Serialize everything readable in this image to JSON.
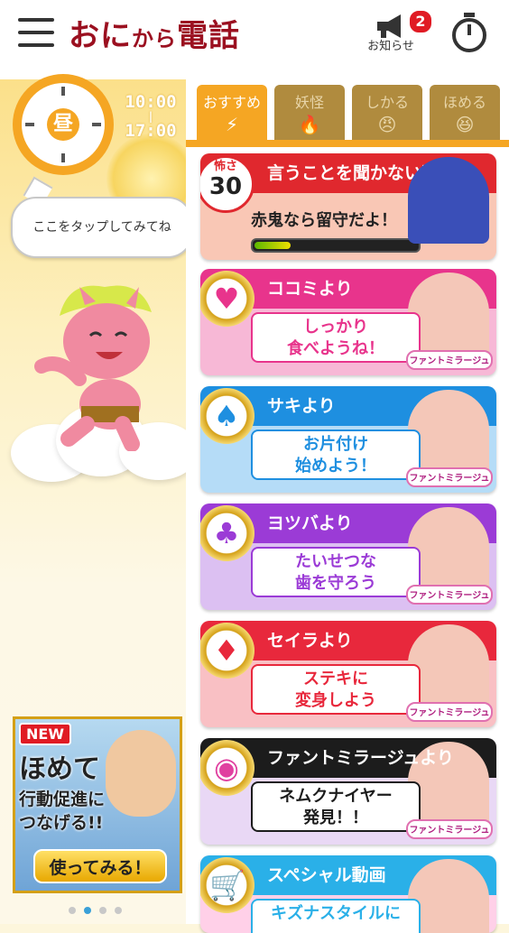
{
  "header": {
    "title_main": "おに",
    "title_small": "から",
    "title_end": "電話",
    "notice_label": "お知らせ",
    "notice_count": "2",
    "icons": {
      "menu": "hamburger-menu-icon",
      "notice": "megaphone-icon",
      "timer": "stopwatch-icon"
    }
  },
  "clock": {
    "period": "昼",
    "start": "10:00",
    "separator": "|",
    "end": "17:00"
  },
  "bubble": {
    "text": "ここをタップしてみてね"
  },
  "tabs": [
    {
      "label": "おすすめ",
      "icon": "lightning-icon",
      "glyph": "⚡",
      "active": true
    },
    {
      "label": "妖怪",
      "icon": "flame-icon",
      "glyph": "🔥",
      "active": false
    },
    {
      "label": "しかる",
      "icon": "angry-face-icon",
      "glyph": "😠",
      "active": false
    },
    {
      "label": "ほめる",
      "icon": "happy-face-icon",
      "glyph": "😆",
      "active": false
    }
  ],
  "oni_card": {
    "fear_label": "怖さ",
    "fear_value": "30",
    "title": "言うことを聞かない時",
    "subtitle": "赤鬼なら留守だよ！",
    "meter_fraction": 0.22
  },
  "cards": [
    {
      "name": "cocomi",
      "suit": "heart",
      "glyph": "♥",
      "from": "ココミより",
      "line1": "しっかり",
      "line2": "食べようね！",
      "head_color": "#e8348c",
      "body_color": "#f7b8d6",
      "photo_color": "#f4c7b8",
      "logo": "ファントミラージュ"
    },
    {
      "name": "saki",
      "suit": "spade",
      "glyph": "♠",
      "from": "サキより",
      "line1": "お片付け",
      "line2": "始めよう！",
      "head_color": "#1e8fe0",
      "body_color": "#b5dcf7",
      "photo_color": "#f4c7b8",
      "logo": "ファントミラージュ"
    },
    {
      "name": "yotsuba",
      "suit": "club",
      "glyph": "♣",
      "from": "ヨツバより",
      "line1": "たいせつな",
      "line2": "歯を守ろう",
      "head_color": "#9b3bd6",
      "body_color": "#dcc0f2",
      "photo_color": "#f4c7b8",
      "logo": "ファントミラージュ"
    },
    {
      "name": "seira",
      "suit": "diamond",
      "glyph": "♦",
      "from": "セイラより",
      "line1": "ステキに",
      "line2": "変身しよう",
      "head_color": "#e8283c",
      "body_color": "#f9c0c4",
      "photo_color": "#f4c7b8",
      "logo": "ファントミラージュ"
    },
    {
      "name": "phantom",
      "suit": "compact",
      "glyph": "◉",
      "from": "ファントミラージュより",
      "line1": "ネムクナイヤー",
      "line2": "発見！！",
      "head_color": "#1c1c1c",
      "body_color": "#e9d8f5",
      "photo_color": "#f4c7b8",
      "logo": "ファントミラージュ"
    },
    {
      "name": "special",
      "suit": "cart",
      "glyph": "🛒",
      "from": "スペシャル動画",
      "line1": "キズナスタイルに",
      "line2": "",
      "head_color": "#2ab0e8",
      "body_color": "#ffd0e8",
      "photo_color": "#f4c7b8",
      "logo": ""
    }
  ],
  "ad": {
    "badge": "NEW",
    "title": "ほめて",
    "line1": "行動促進に",
    "line2": "つなげる!!",
    "button": "使ってみる！"
  },
  "pager": {
    "count": 4,
    "active_index": 1
  }
}
